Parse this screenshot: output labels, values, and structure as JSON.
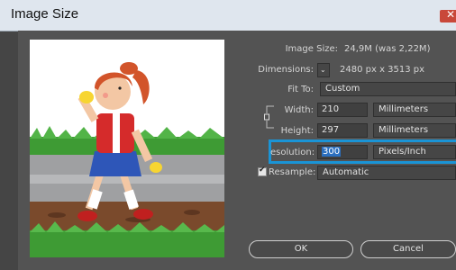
{
  "window": {
    "title": "Image Size"
  },
  "info": {
    "image_size_label": "Image Size:",
    "image_size_value": "24,9M (was 2,22M)",
    "dimensions_label": "Dimensions:",
    "dimensions_value": "2480 px  x  3513 px"
  },
  "fit_to": {
    "label": "Fit To:",
    "value": "Custom"
  },
  "width": {
    "label": "Width:",
    "value": "210",
    "unit": "Millimeters"
  },
  "height": {
    "label": "Height:",
    "value": "297",
    "unit": "Millimeters"
  },
  "resolution": {
    "label": "esolution:",
    "value": "300",
    "unit": "Pixels/Inch"
  },
  "resample": {
    "label": "Resample:",
    "value": "Automatic",
    "checked": true
  },
  "buttons": {
    "ok": "OK",
    "cancel": "Cancel"
  }
}
